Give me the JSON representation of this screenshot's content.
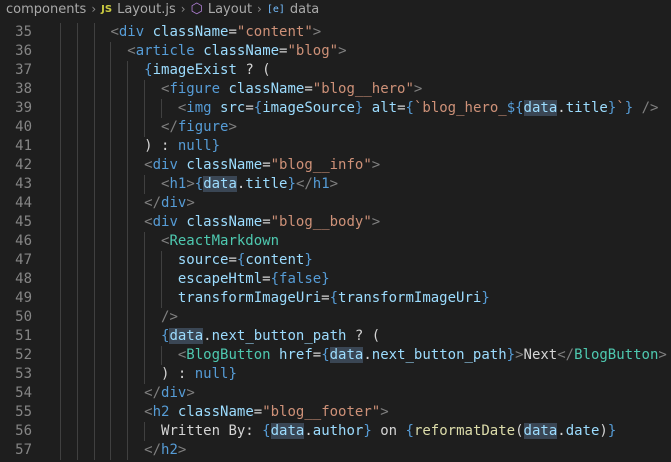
{
  "breadcrumb": {
    "items": [
      {
        "label": "components",
        "icon": ""
      },
      {
        "label": "Layout.js",
        "icon": "js-file-icon",
        "icon_text": "JS"
      },
      {
        "label": "Layout",
        "icon": "component-cube-icon"
      },
      {
        "label": "data",
        "icon": "variable-icon",
        "icon_text": "[e]"
      }
    ]
  },
  "colors": {
    "background": "#1e1e1e",
    "tag": "#569cd6",
    "component": "#4ec9b0",
    "attribute": "#9cdcfe",
    "string": "#ce9178",
    "function": "#dcdcaa",
    "text": "#d4d4d4",
    "highlight": "#3a4654"
  },
  "editor": {
    "lines": [
      {
        "num": "35",
        "tokens": [
          [
            "x",
            "        "
          ],
          [
            "p",
            "<"
          ],
          [
            "t",
            "div"
          ],
          [
            "x",
            " "
          ],
          [
            "a",
            "className"
          ],
          [
            "x",
            "="
          ],
          [
            "s",
            "\"content\""
          ],
          [
            "p",
            ">"
          ]
        ]
      },
      {
        "num": "36",
        "tokens": [
          [
            "x",
            "          "
          ],
          [
            "p",
            "<"
          ],
          [
            "t",
            "article"
          ],
          [
            "x",
            " "
          ],
          [
            "a",
            "className"
          ],
          [
            "x",
            "="
          ],
          [
            "s",
            "\"blog\""
          ],
          [
            "p",
            ">"
          ]
        ]
      },
      {
        "num": "37",
        "tokens": [
          [
            "x",
            "            "
          ],
          [
            "b",
            "{"
          ],
          [
            "v",
            "imageExist"
          ],
          [
            "x",
            " ? ("
          ]
        ]
      },
      {
        "num": "38",
        "tokens": [
          [
            "x",
            "              "
          ],
          [
            "p",
            "<"
          ],
          [
            "t",
            "figure"
          ],
          [
            "x",
            " "
          ],
          [
            "a",
            "className"
          ],
          [
            "x",
            "="
          ],
          [
            "s",
            "\"blog__hero\""
          ],
          [
            "p",
            ">"
          ]
        ]
      },
      {
        "num": "39",
        "tokens": [
          [
            "x",
            "                "
          ],
          [
            "p",
            "<"
          ],
          [
            "t",
            "img"
          ],
          [
            "x",
            " "
          ],
          [
            "a",
            "src"
          ],
          [
            "x",
            "="
          ],
          [
            "b",
            "{"
          ],
          [
            "v",
            "imageSource"
          ],
          [
            "b",
            "}"
          ],
          [
            "x",
            " "
          ],
          [
            "a",
            "alt"
          ],
          [
            "x",
            "="
          ],
          [
            "b",
            "{"
          ],
          [
            "s",
            "`blog_hero_"
          ],
          [
            "b",
            "${"
          ],
          [
            "h",
            "data"
          ],
          [
            "x",
            "."
          ],
          [
            "v",
            "title"
          ],
          [
            "b",
            "}"
          ],
          [
            "s",
            "`"
          ],
          [
            "b",
            "}"
          ],
          [
            "x",
            " "
          ],
          [
            "p",
            "/>"
          ]
        ]
      },
      {
        "num": "40",
        "tokens": [
          [
            "x",
            "              "
          ],
          [
            "p",
            "</"
          ],
          [
            "t",
            "figure"
          ],
          [
            "p",
            ">"
          ]
        ]
      },
      {
        "num": "41",
        "tokens": [
          [
            "x",
            "            "
          ],
          [
            "x",
            ") : "
          ],
          [
            "k",
            "null"
          ],
          [
            "b",
            "}"
          ]
        ]
      },
      {
        "num": "42",
        "tokens": [
          [
            "x",
            "            "
          ],
          [
            "p",
            "<"
          ],
          [
            "t",
            "div"
          ],
          [
            "x",
            " "
          ],
          [
            "a",
            "className"
          ],
          [
            "x",
            "="
          ],
          [
            "s",
            "\"blog__info\""
          ],
          [
            "p",
            ">"
          ]
        ]
      },
      {
        "num": "43",
        "tokens": [
          [
            "x",
            "              "
          ],
          [
            "p",
            "<"
          ],
          [
            "t",
            "h1"
          ],
          [
            "p",
            ">"
          ],
          [
            "b",
            "{"
          ],
          [
            "h",
            "data"
          ],
          [
            "x",
            "."
          ],
          [
            "v",
            "title"
          ],
          [
            "b",
            "}"
          ],
          [
            "p",
            "</"
          ],
          [
            "t",
            "h1"
          ],
          [
            "p",
            ">"
          ]
        ]
      },
      {
        "num": "44",
        "tokens": [
          [
            "x",
            "            "
          ],
          [
            "p",
            "</"
          ],
          [
            "t",
            "div"
          ],
          [
            "p",
            ">"
          ]
        ]
      },
      {
        "num": "45",
        "tokens": [
          [
            "x",
            "            "
          ],
          [
            "p",
            "<"
          ],
          [
            "t",
            "div"
          ],
          [
            "x",
            " "
          ],
          [
            "a",
            "className"
          ],
          [
            "x",
            "="
          ],
          [
            "s",
            "\"blog__body\""
          ],
          [
            "p",
            ">"
          ]
        ]
      },
      {
        "num": "46",
        "tokens": [
          [
            "x",
            "              "
          ],
          [
            "p",
            "<"
          ],
          [
            "c",
            "ReactMarkdown"
          ]
        ]
      },
      {
        "num": "47",
        "tokens": [
          [
            "x",
            "                "
          ],
          [
            "a",
            "source"
          ],
          [
            "x",
            "="
          ],
          [
            "b",
            "{"
          ],
          [
            "v",
            "content"
          ],
          [
            "b",
            "}"
          ]
        ]
      },
      {
        "num": "48",
        "tokens": [
          [
            "x",
            "                "
          ],
          [
            "a",
            "escapeHtml"
          ],
          [
            "x",
            "="
          ],
          [
            "b",
            "{"
          ],
          [
            "k",
            "false"
          ],
          [
            "b",
            "}"
          ]
        ]
      },
      {
        "num": "49",
        "tokens": [
          [
            "x",
            "                "
          ],
          [
            "a",
            "transformImageUri"
          ],
          [
            "x",
            "="
          ],
          [
            "b",
            "{"
          ],
          [
            "v",
            "transformImageUri"
          ],
          [
            "b",
            "}"
          ]
        ]
      },
      {
        "num": "50",
        "tokens": [
          [
            "x",
            "              "
          ],
          [
            "p",
            "/>"
          ]
        ]
      },
      {
        "num": "51",
        "tokens": [
          [
            "x",
            "              "
          ],
          [
            "b",
            "{"
          ],
          [
            "h",
            "data"
          ],
          [
            "x",
            "."
          ],
          [
            "v",
            "next_button_path"
          ],
          [
            "x",
            " ? ("
          ]
        ]
      },
      {
        "num": "52",
        "tokens": [
          [
            "x",
            "                "
          ],
          [
            "p",
            "<"
          ],
          [
            "c",
            "BlogButton"
          ],
          [
            "x",
            " "
          ],
          [
            "a",
            "href"
          ],
          [
            "x",
            "="
          ],
          [
            "b",
            "{"
          ],
          [
            "h",
            "data"
          ],
          [
            "x",
            "."
          ],
          [
            "v",
            "next_button_path"
          ],
          [
            "b",
            "}"
          ],
          [
            "p",
            ">"
          ],
          [
            "x",
            "Next"
          ],
          [
            "p",
            "</"
          ],
          [
            "c",
            "BlogButton"
          ],
          [
            "p",
            ">"
          ]
        ]
      },
      {
        "num": "53",
        "tokens": [
          [
            "x",
            "              "
          ],
          [
            "x",
            ") : "
          ],
          [
            "k",
            "null"
          ],
          [
            "b",
            "}"
          ]
        ]
      },
      {
        "num": "54",
        "tokens": [
          [
            "x",
            "            "
          ],
          [
            "p",
            "</"
          ],
          [
            "t",
            "div"
          ],
          [
            "p",
            ">"
          ]
        ]
      },
      {
        "num": "55",
        "tokens": [
          [
            "x",
            "            "
          ],
          [
            "p",
            "<"
          ],
          [
            "t",
            "h2"
          ],
          [
            "x",
            " "
          ],
          [
            "a",
            "className"
          ],
          [
            "x",
            "="
          ],
          [
            "s",
            "\"blog__footer\""
          ],
          [
            "p",
            ">"
          ]
        ]
      },
      {
        "num": "56",
        "tokens": [
          [
            "x",
            "              "
          ],
          [
            "x",
            "Written By: "
          ],
          [
            "b",
            "{"
          ],
          [
            "h",
            "data"
          ],
          [
            "x",
            "."
          ],
          [
            "v",
            "author"
          ],
          [
            "b",
            "}"
          ],
          [
            "x",
            " on "
          ],
          [
            "b",
            "{"
          ],
          [
            "f",
            "reformatDate"
          ],
          [
            "x",
            "("
          ],
          [
            "h",
            "data"
          ],
          [
            "x",
            "."
          ],
          [
            "v",
            "date"
          ],
          [
            "x",
            ")"
          ],
          [
            "b",
            "}"
          ]
        ]
      },
      {
        "num": "57",
        "tokens": [
          [
            "x",
            "            "
          ],
          [
            "p",
            "</"
          ],
          [
            "t",
            "h2"
          ],
          [
            "p",
            ">"
          ]
        ]
      }
    ]
  }
}
